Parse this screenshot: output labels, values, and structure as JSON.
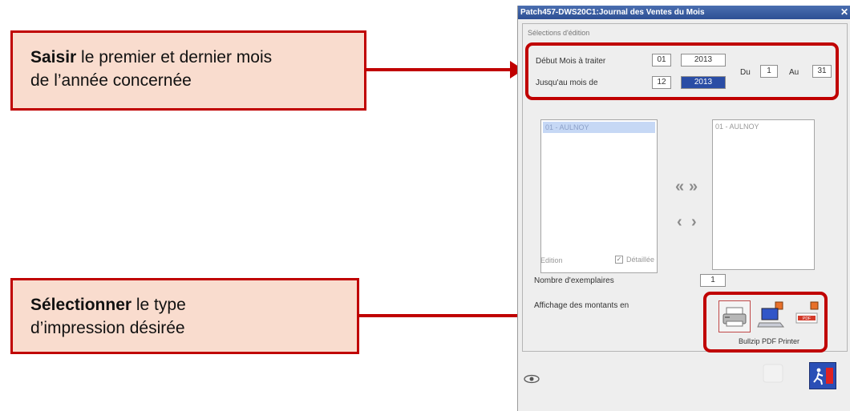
{
  "callouts": {
    "top": {
      "bold": "Saisir",
      "rest_line1": " le premier et dernier mois",
      "line2": "de l’année concernée"
    },
    "bottom": {
      "bold": "Sélectionner",
      "rest_line1": " le type",
      "line2": "d’impression désirée"
    }
  },
  "dialog": {
    "title": "Patch457-DWS20C1:Journal des Ventes du Mois",
    "close": "✕",
    "group_label": "Sélections d'édition",
    "debut_label": "Début Mois à traiter",
    "debut_month": "01",
    "debut_year": "2013",
    "jusqua_label": "Jusqu'au mois de",
    "jusqua_month": "12",
    "jusqua_year": "2013",
    "du_label": "Du",
    "du_value": "1",
    "au_label": "Au",
    "au_value": "31",
    "list_left_item": "01 - AULNOY",
    "list_right_item": "01 - AULNOY",
    "move_all_right": "»",
    "move_all_left": "«",
    "move_one_right": "›",
    "move_one_left": "‹",
    "edition_label": "Edition",
    "detaillee_label": "Détaillée",
    "detaillee_checked": "✓",
    "exemplaires_label": "Nombre d'exemplaires",
    "exemplaires_value": "1",
    "affichage_label": "Affichage des montants en",
    "printer_name": "Bullzip PDF Printer",
    "pdf_badge": "PDF"
  },
  "colors": {
    "accent_red": "#c00000",
    "callout_fill": "#f9dcce",
    "title_blue": "#2d4f94"
  },
  "icons": [
    "printer-icon",
    "screen-icon",
    "pdf-icon",
    "exit-door-icon",
    "eye-icon",
    "close-icon"
  ]
}
